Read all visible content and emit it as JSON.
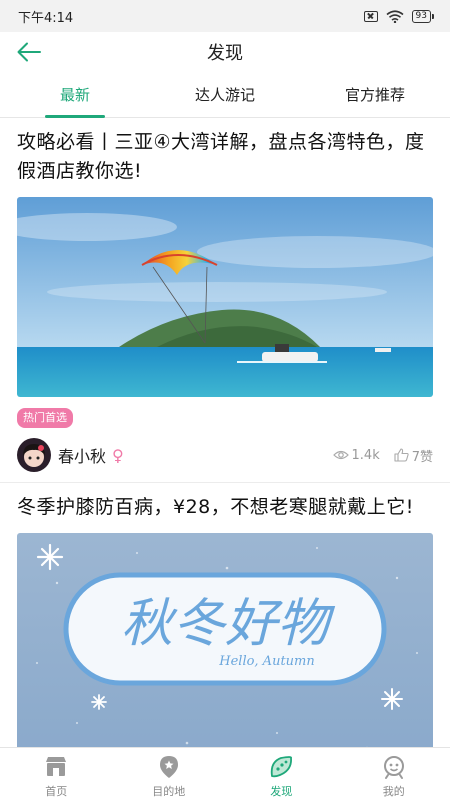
{
  "status_bar": {
    "time": "下午4:14",
    "battery": "93"
  },
  "header": {
    "title": "发现"
  },
  "tabs": [
    {
      "label": "最新",
      "active": true
    },
    {
      "label": "达人游记",
      "active": false
    },
    {
      "label": "官方推荐",
      "active": false
    }
  ],
  "articles": [
    {
      "title": "攻略必看丨三亚④大湾详解，盘点各湾特色，度假酒店教你选!",
      "tag": "热门首选",
      "author": "春小秋",
      "gender_symbol": "♀",
      "views": "1.4k",
      "likes": "7赞"
    },
    {
      "title": "冬季护膝防百病，¥28，不想老寒腿就戴上它!",
      "cover_text": "秋冬好物",
      "cover_subtext": "Hello, Autumn"
    }
  ],
  "bottom_nav": [
    {
      "label": "首页",
      "icon": "store-icon"
    },
    {
      "label": "目的地",
      "icon": "location-pin-icon"
    },
    {
      "label": "发现",
      "icon": "discover-leaf-icon",
      "active": true
    },
    {
      "label": "我的",
      "icon": "profile-face-icon"
    }
  ],
  "colors": {
    "accent": "#1fa87a",
    "tag": "#f07aa8"
  }
}
